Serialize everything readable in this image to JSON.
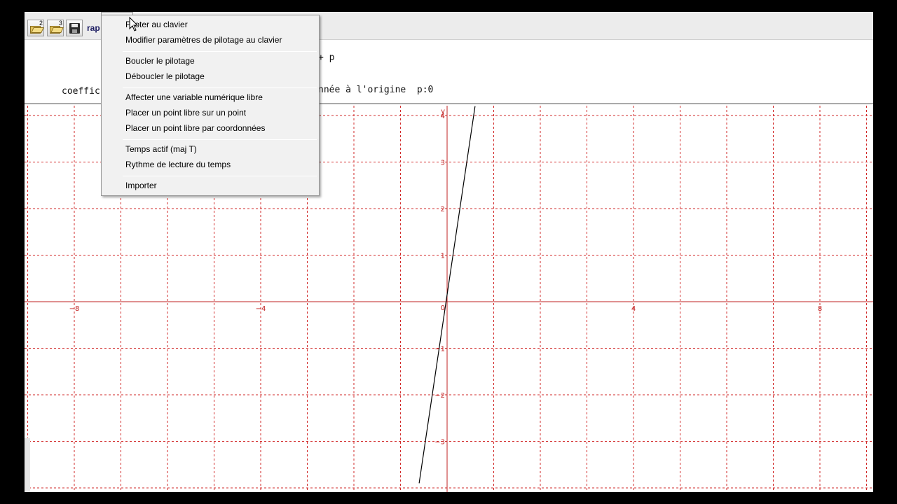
{
  "toolbar": {
    "open2_badge": "2",
    "open3_badge": "3",
    "rap_label": "rap"
  },
  "header": {
    "equation_suffix": "+ p",
    "info_left": "coeffic",
    "info_right": "nnée à l'origine  p:0"
  },
  "menu": {
    "items": [
      {
        "label": "Piloter au clavier"
      },
      {
        "label": "Modifier paramètres de pilotage au clavier"
      },
      {
        "label": "Boucler le pilotage"
      },
      {
        "label": "Déboucler le pilotage"
      },
      {
        "label": "Affecter une variable numérique libre"
      },
      {
        "label": "Placer un point libre sur un point"
      },
      {
        "label": "Placer un point libre par coordonnées"
      },
      {
        "label": "Temps actif (maj T)"
      },
      {
        "label": "Rythme de lecture du temps"
      },
      {
        "label": "Importer"
      }
    ]
  },
  "chart_data": {
    "type": "line",
    "title": "",
    "xlabel": "",
    "ylabel": "y",
    "xlim": [
      -9,
      9.1
    ],
    "ylim": [
      -4.1,
      4.2
    ],
    "x_ticks": [
      -8,
      -4,
      4,
      8
    ],
    "y_ticks": [
      -3,
      -2,
      -1,
      1,
      2,
      3,
      4
    ],
    "origin_label": "0",
    "grid": true,
    "grid_color": "#d22b2b",
    "axis_color": "#c02020",
    "series": [
      {
        "values": [
          [
            -0.6,
            -3.9
          ],
          [
            0.6,
            4.2
          ]
        ],
        "color": "#000000"
      }
    ]
  }
}
